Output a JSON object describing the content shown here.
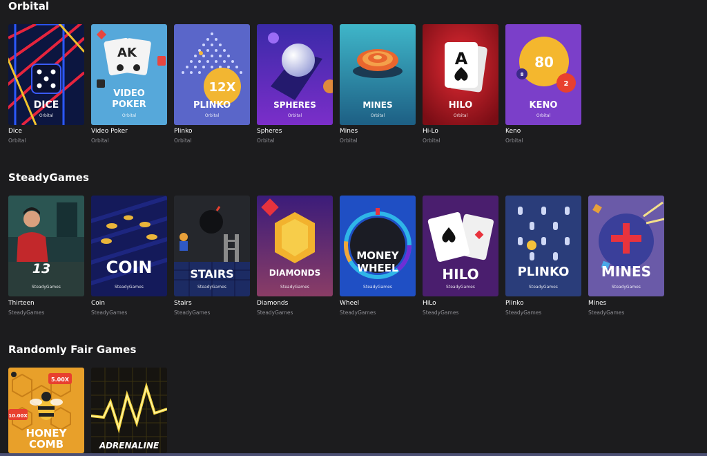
{
  "sections": [
    {
      "title": "Orbital",
      "games": [
        {
          "title": "Dice",
          "provider": "Orbital",
          "banner": "DICE",
          "banner_provider": "Orbital"
        },
        {
          "title": "Video Poker",
          "provider": "Orbital",
          "banner": "VIDEO POKER",
          "banner_line1": "VIDEO",
          "banner_line2": "POKER",
          "banner_provider": "Orbital",
          "card_text": "AK"
        },
        {
          "title": "Plinko",
          "provider": "Orbital",
          "banner": "PLINKO",
          "banner_provider": "Orbital",
          "multiplier": "12X"
        },
        {
          "title": "Spheres",
          "provider": "Orbital",
          "banner": "SPHERES",
          "banner_provider": "Orbital"
        },
        {
          "title": "Mines",
          "provider": "Orbital",
          "banner": "MINES",
          "banner_provider": "Orbital"
        },
        {
          "title": "Hi-Lo",
          "provider": "Orbital",
          "banner": "HILO",
          "banner_provider": "Orbital",
          "card_rank": "A"
        },
        {
          "title": "Keno",
          "provider": "Orbital",
          "banner": "KENO",
          "banner_provider": "Orbital",
          "ball_big": "80",
          "ball_small": "2",
          "ball_tiny": "8"
        }
      ]
    },
    {
      "title": "SteadyGames",
      "games": [
        {
          "title": "Thirteen",
          "provider": "SteadyGames",
          "banner": "13",
          "banner_provider": "SteadyGames"
        },
        {
          "title": "Coin",
          "provider": "SteadyGames",
          "banner": "COIN",
          "banner_provider": "SteadyGames"
        },
        {
          "title": "Stairs",
          "provider": "SteadyGames",
          "banner": "STAIRS",
          "banner_provider": "SteadyGames"
        },
        {
          "title": "Diamonds",
          "provider": "SteadyGames",
          "banner": "DIAMONDS",
          "banner_provider": "SteadyGames"
        },
        {
          "title": "Wheel",
          "provider": "SteadyGames",
          "banner_line1": "MONEY",
          "banner_line2": "WHEEL",
          "banner_provider": "SteadyGames"
        },
        {
          "title": "HiLo",
          "provider": "SteadyGames",
          "banner": "HILO",
          "banner_provider": "SteadyGames"
        },
        {
          "title": "Plinko",
          "provider": "SteadyGames",
          "banner": "PLINKO",
          "banner_provider": "SteadyGames"
        },
        {
          "title": "Mines",
          "provider": "SteadyGames",
          "banner": "MINES",
          "banner_provider": "SteadyGames"
        }
      ]
    },
    {
      "title": "Randomly Fair Games",
      "games": [
        {
          "title": "Honeycomb",
          "banner_line1": "HONEY",
          "banner_line2": "COMB",
          "mult_a": "5.00X",
          "mult_b": "10.00X"
        },
        {
          "title": "Adrenaline",
          "banner": "ADRENALINE"
        }
      ]
    }
  ],
  "colors": {
    "background": "#1c1c1e",
    "title_text": "#ffffff",
    "provider_text": "#8d8d93",
    "bottom_bar": "#4b4f73"
  }
}
